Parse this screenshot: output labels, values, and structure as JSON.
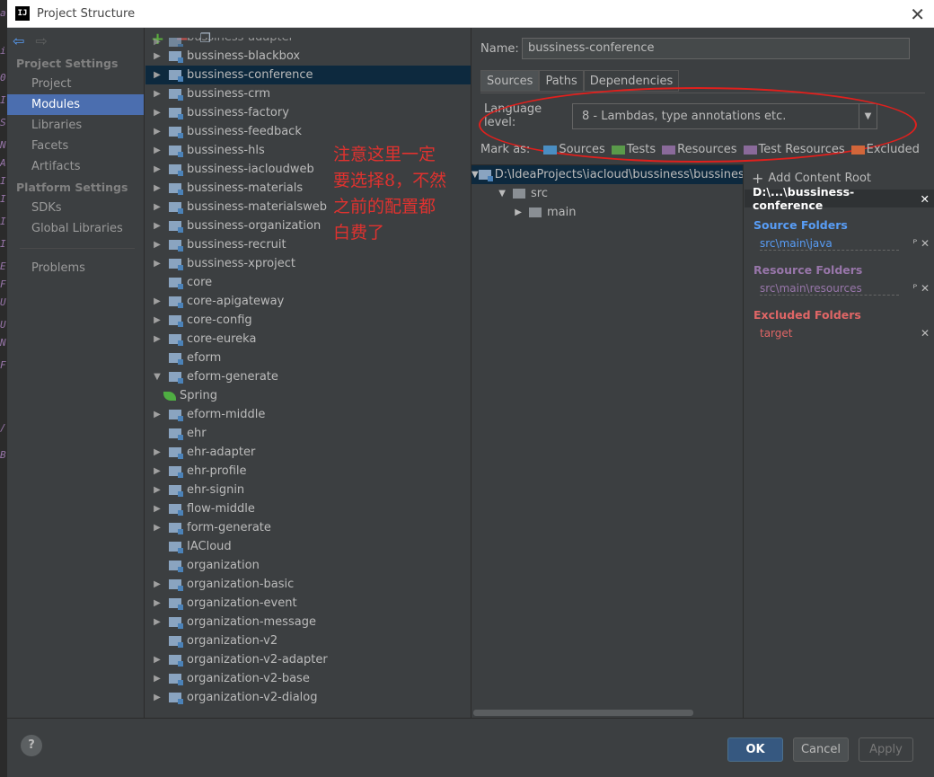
{
  "window": {
    "title": "Project Structure",
    "app_icon_label": "IJ"
  },
  "background_strip": [
    "a",
    "i",
    "0",
    "I",
    "S",
    "N",
    "A",
    "I",
    "I",
    "I",
    "I",
    "E",
    "F",
    "U",
    "U",
    "N",
    "F",
    "/",
    "B"
  ],
  "leftnav": {
    "project_settings_header": "Project Settings",
    "project_settings_items": [
      "Project",
      "Modules",
      "Libraries",
      "Facets",
      "Artifacts"
    ],
    "platform_settings_header": "Platform Settings",
    "platform_settings_items": [
      "SDKs",
      "Global Libraries"
    ],
    "problems": "Problems",
    "selected": "Modules"
  },
  "modules": {
    "partial_top": "bussiness-adapter",
    "items": [
      {
        "label": "bussiness-blackbox",
        "expandable": true
      },
      {
        "label": "bussiness-conference",
        "expandable": true,
        "selected": true
      },
      {
        "label": "bussiness-crm",
        "expandable": true
      },
      {
        "label": "bussiness-factory",
        "expandable": true
      },
      {
        "label": "bussiness-feedback",
        "expandable": true
      },
      {
        "label": "bussiness-hls",
        "expandable": true
      },
      {
        "label": "bussiness-iacloudweb",
        "expandable": true
      },
      {
        "label": "bussiness-materials",
        "expandable": true
      },
      {
        "label": "bussiness-materialsweb",
        "expandable": true
      },
      {
        "label": "bussiness-organization",
        "expandable": true
      },
      {
        "label": "bussiness-recruit",
        "expandable": true
      },
      {
        "label": "bussiness-xproject",
        "expandable": true
      },
      {
        "label": "core",
        "expandable": false
      },
      {
        "label": "core-apigateway",
        "expandable": true
      },
      {
        "label": "core-config",
        "expandable": true
      },
      {
        "label": "core-eureka",
        "expandable": true
      },
      {
        "label": "eform",
        "expandable": false
      },
      {
        "label": "eform-generate",
        "expandable": true,
        "expanded": true
      },
      {
        "label": "Spring",
        "child": true
      },
      {
        "label": "eform-middle",
        "expandable": true
      },
      {
        "label": "ehr",
        "expandable": false
      },
      {
        "label": "ehr-adapter",
        "expandable": true
      },
      {
        "label": "ehr-profile",
        "expandable": true
      },
      {
        "label": "ehr-signin",
        "expandable": true
      },
      {
        "label": "flow-middle",
        "expandable": true
      },
      {
        "label": "form-generate",
        "expandable": true
      },
      {
        "label": "IACloud",
        "expandable": false
      },
      {
        "label": "organization",
        "expandable": false
      },
      {
        "label": "organization-basic",
        "expandable": true
      },
      {
        "label": "organization-event",
        "expandable": true
      },
      {
        "label": "organization-message",
        "expandable": true
      },
      {
        "label": "organization-v2",
        "expandable": false
      },
      {
        "label": "organization-v2-adapter",
        "expandable": true
      },
      {
        "label": "organization-v2-base",
        "expandable": true
      },
      {
        "label": "organization-v2-dialog",
        "expandable": true
      }
    ]
  },
  "annotation": {
    "lines": [
      "注意这里一定",
      "要选择8，不然",
      "之前的配置都",
      "白费了"
    ],
    "color": "#e0322f"
  },
  "detail": {
    "name_label": "Name:",
    "name_value": "bussiness-conference",
    "tabs": [
      "Sources",
      "Paths",
      "Dependencies"
    ],
    "active_tab": "Sources",
    "language_level_label": "Language level:",
    "language_level_value": "8 - Lambdas, type annotations etc.",
    "mark_as_label": "Mark as:",
    "mark_as": [
      {
        "label": "Sources",
        "color": "#4a8ec2"
      },
      {
        "label": "Tests",
        "color": "#5a9a4a"
      },
      {
        "label": "Resources",
        "color": "#8a6a9a"
      },
      {
        "label": "Test Resources",
        "color": "#8a6a9a"
      },
      {
        "label": "Excluded",
        "color": "#d2663a"
      }
    ],
    "content_tree": {
      "root": "D:\\IdeaProjects\\iacloud\\bussiness\\bussiness-",
      "children": [
        "src",
        "main"
      ]
    },
    "add_content_root": "Add Content Root",
    "root_path": "D:\\...\\bussiness-conference",
    "source_folders_title": "Source Folders",
    "source_folders": [
      "src\\main\\java"
    ],
    "resource_folders_title": "Resource Folders",
    "resource_folders": [
      "src\\main\\resources"
    ],
    "excluded_folders_title": "Excluded Folders",
    "excluded_folders": [
      "target"
    ],
    "colors": {
      "source": "#589df6",
      "resource": "#9876aa",
      "excluded": "#e06666"
    }
  },
  "footer": {
    "help": "?",
    "ok": "OK",
    "cancel": "Cancel",
    "apply": "Apply"
  }
}
